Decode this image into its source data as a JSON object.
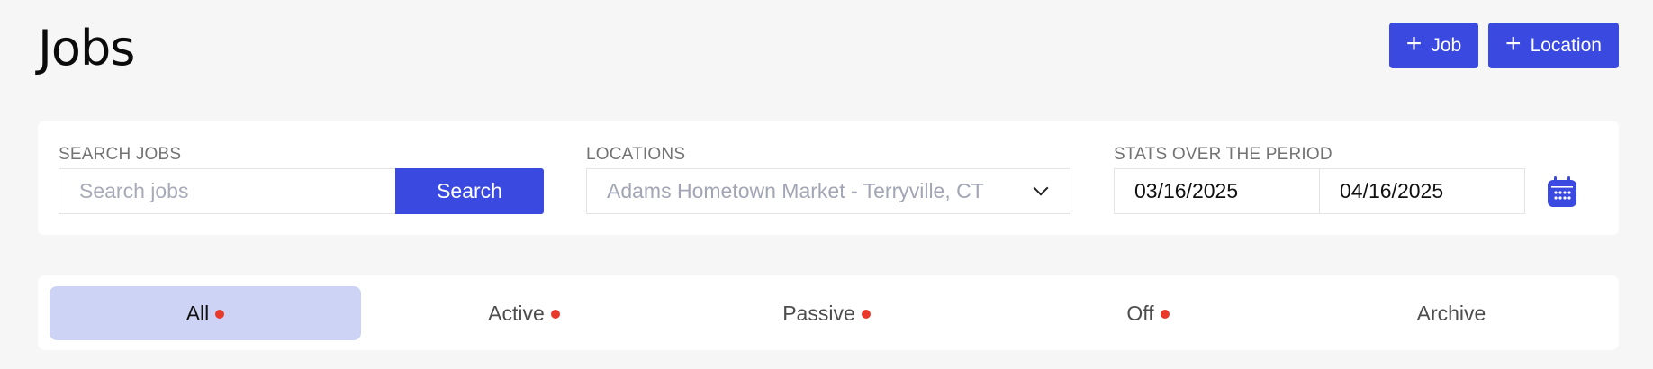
{
  "header": {
    "title": "Jobs",
    "add_job_label": "Job",
    "add_location_label": "Location"
  },
  "filters": {
    "search": {
      "label": "SEARCH JOBS",
      "placeholder": "Search jobs",
      "button_label": "Search"
    },
    "locations": {
      "label": "LOCATIONS",
      "selected": "Adams Hometown Market - Terryville, CT"
    },
    "period": {
      "label": "STATS OVER THE PERIOD",
      "start": "03/16/2025",
      "end": "04/16/2025"
    }
  },
  "tabs": [
    {
      "label": "All",
      "dot": true,
      "active": true
    },
    {
      "label": "Active",
      "dot": true,
      "active": false
    },
    {
      "label": "Passive",
      "dot": true,
      "active": false
    },
    {
      "label": "Off",
      "dot": true,
      "active": false
    },
    {
      "label": "Archive",
      "dot": false,
      "active": false
    }
  ],
  "colors": {
    "accent": "#3a49e0",
    "active_tab_bg": "#cdd3f5",
    "status_dot": "#e8392b",
    "page_bg": "#f6f6f6"
  }
}
